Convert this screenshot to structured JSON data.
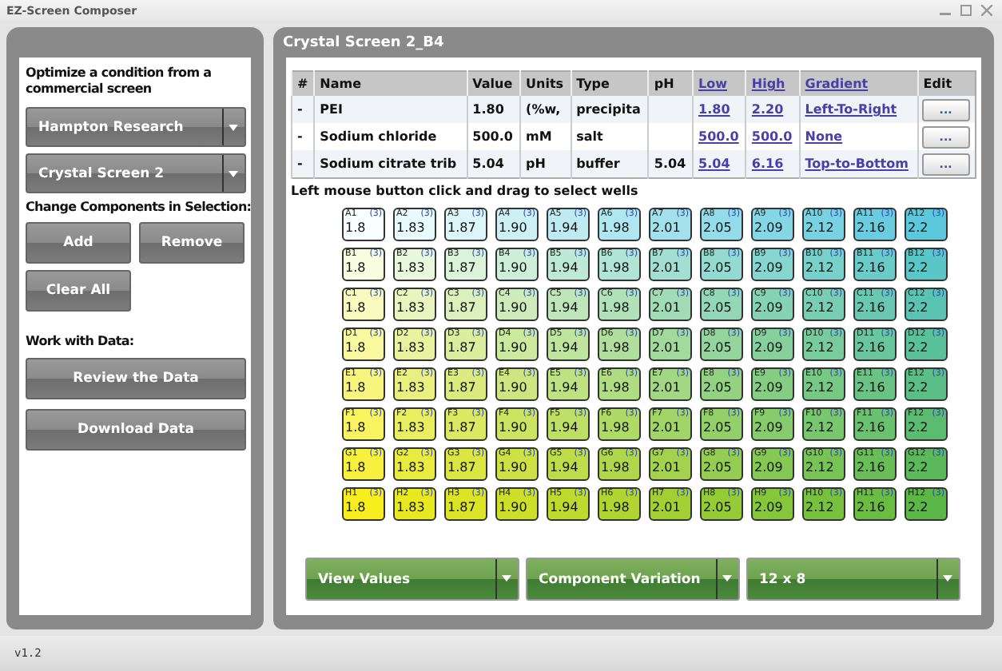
{
  "window": {
    "title": "EZ-Screen Composer"
  },
  "left_panel": {
    "heading": "Optimize a condition from a commercial screen",
    "dropdowns": [
      {
        "value": "Hampton Research"
      },
      {
        "value": "Crystal Screen 2"
      }
    ],
    "components_heading": "Change Components in Selection:",
    "component_buttons": [
      "Add",
      "Remove",
      "Clear All"
    ],
    "data_heading": "Work with Data:",
    "data_buttons": [
      "Review the Data",
      "Download Data"
    ]
  },
  "right_panel": {
    "title": "Crystal Screen 2_B4",
    "table": {
      "columns": [
        {
          "label": "#",
          "link": false
        },
        {
          "label": "Name",
          "link": false
        },
        {
          "label": "Value",
          "link": false
        },
        {
          "label": "Units",
          "link": false
        },
        {
          "label": "Type",
          "link": false
        },
        {
          "label": "pH",
          "link": false
        },
        {
          "label": "Low",
          "link": true
        },
        {
          "label": "High",
          "link": true
        },
        {
          "label": "Gradient",
          "link": true
        },
        {
          "label": "Edit",
          "link": false
        }
      ],
      "rows": [
        {
          "num": "-",
          "name": "PEI",
          "value": "1.80",
          "units": "(%w,",
          "type": "precipita",
          "ph": "",
          "low": "1.80",
          "high": "2.20",
          "gradient": "Left-To-Right",
          "edit": "..."
        },
        {
          "num": "-",
          "name": "Sodium chloride",
          "value": "500.0",
          "units": "mM",
          "type": "salt",
          "ph": "",
          "low": "500.0",
          "high": "500.0",
          "gradient": "None",
          "edit": "..."
        },
        {
          "num": "-",
          "name": "Sodium citrate trib",
          "value": "5.04",
          "units": "pH",
          "type": "buffer",
          "ph": "5.04",
          "low": "5.04",
          "high": "6.16",
          "gradient": "Top-to-Bottom",
          "edit": "..."
        }
      ]
    },
    "hint": "Left mouse button click and drag to select wells",
    "plate": [
      {
        "wells": [
          {
            "label": "A1",
            "count": "(3)",
            "value": "1.8",
            "color": "#f8ffff"
          },
          {
            "label": "A2",
            "count": "(3)",
            "value": "1.83",
            "color": "#e9fafc"
          },
          {
            "label": "A3",
            "count": "(3)",
            "value": "1.87",
            "color": "#dbf5f9"
          },
          {
            "label": "A4",
            "count": "(3)",
            "value": "1.90",
            "color": "#cdf0f5"
          },
          {
            "label": "A5",
            "count": "(3)",
            "value": "1.94",
            "color": "#beebf2"
          },
          {
            "label": "A6",
            "count": "(3)",
            "value": "1.98",
            "color": "#b0e6ef"
          },
          {
            "label": "A7",
            "count": "(3)",
            "value": "2.01",
            "color": "#a2e1ec"
          },
          {
            "label": "A8",
            "count": "(3)",
            "value": "2.05",
            "color": "#94dce9"
          },
          {
            "label": "A9",
            "count": "(3)",
            "value": "2.09",
            "color": "#86d7e6"
          },
          {
            "label": "A10",
            "count": "(3)",
            "value": "2.12",
            "color": "#78d2e2"
          },
          {
            "label": "A11",
            "count": "(3)",
            "value": "2.16",
            "color": "#6acddf"
          },
          {
            "label": "A12",
            "count": "(3)",
            "value": "2.2",
            "color": "#5bc8dc"
          }
        ]
      },
      {
        "wells": [
          {
            "label": "B1",
            "count": "(3)",
            "value": "1.8",
            "color": "#f8fddf"
          },
          {
            "label": "B2",
            "count": "(3)",
            "value": "1.83",
            "color": "#e9f8dd"
          },
          {
            "label": "B3",
            "count": "(3)",
            "value": "1.87",
            "color": "#dbf3db"
          },
          {
            "label": "B4",
            "count": "(3)",
            "value": "1.90",
            "color": "#cdeed8"
          },
          {
            "label": "B5",
            "count": "(3)",
            "value": "1.94",
            "color": "#bee9d6"
          },
          {
            "label": "B6",
            "count": "(3)",
            "value": "1.98",
            "color": "#b0e4d4"
          },
          {
            "label": "B7",
            "count": "(3)",
            "value": "2.01",
            "color": "#a2dfd2"
          },
          {
            "label": "B8",
            "count": "(3)",
            "value": "2.05",
            "color": "#94dad0"
          },
          {
            "label": "B9",
            "count": "(3)",
            "value": "2.09",
            "color": "#86d5ce"
          },
          {
            "label": "B10",
            "count": "(3)",
            "value": "2.12",
            "color": "#78d0cb"
          },
          {
            "label": "B11",
            "count": "(3)",
            "value": "2.16",
            "color": "#6acbc9"
          },
          {
            "label": "B12",
            "count": "(3)",
            "value": "2.2",
            "color": "#5bc6c7"
          }
        ]
      },
      {
        "wells": [
          {
            "label": "C1",
            "count": "(3)",
            "value": "1.8",
            "color": "#f8fabf"
          },
          {
            "label": "C2",
            "count": "(3)",
            "value": "1.83",
            "color": "#e9f5be"
          },
          {
            "label": "C3",
            "count": "(3)",
            "value": "1.87",
            "color": "#dbf0bc"
          },
          {
            "label": "C4",
            "count": "(3)",
            "value": "1.90",
            "color": "#cdebbb"
          },
          {
            "label": "C5",
            "count": "(3)",
            "value": "1.94",
            "color": "#bee6ba"
          },
          {
            "label": "C6",
            "count": "(3)",
            "value": "1.98",
            "color": "#b0e1b8"
          },
          {
            "label": "C7",
            "count": "(3)",
            "value": "2.01",
            "color": "#a2dcb7"
          },
          {
            "label": "C8",
            "count": "(3)",
            "value": "2.05",
            "color": "#94d7b6"
          },
          {
            "label": "C9",
            "count": "(3)",
            "value": "2.09",
            "color": "#86d2b5"
          },
          {
            "label": "C10",
            "count": "(3)",
            "value": "2.12",
            "color": "#78cdb3"
          },
          {
            "label": "C11",
            "count": "(3)",
            "value": "2.16",
            "color": "#6ac8b2"
          },
          {
            "label": "C12",
            "count": "(3)",
            "value": "2.2",
            "color": "#5bc3b1"
          }
        ]
      },
      {
        "wells": [
          {
            "label": "D1",
            "count": "(3)",
            "value": "1.8",
            "color": "#f8f89f"
          },
          {
            "label": "D2",
            "count": "(3)",
            "value": "1.83",
            "color": "#e9f39f"
          },
          {
            "label": "D3",
            "count": "(3)",
            "value": "1.87",
            "color": "#dbee9e"
          },
          {
            "label": "D4",
            "count": "(3)",
            "value": "1.90",
            "color": "#cde99e"
          },
          {
            "label": "D5",
            "count": "(3)",
            "value": "1.94",
            "color": "#bee49e"
          },
          {
            "label": "D6",
            "count": "(3)",
            "value": "1.98",
            "color": "#b0df9d"
          },
          {
            "label": "D7",
            "count": "(3)",
            "value": "2.01",
            "color": "#a2da9d"
          },
          {
            "label": "D8",
            "count": "(3)",
            "value": "2.05",
            "color": "#94d59d"
          },
          {
            "label": "D9",
            "count": "(3)",
            "value": "2.09",
            "color": "#86d09d"
          },
          {
            "label": "D10",
            "count": "(3)",
            "value": "2.12",
            "color": "#78cb9c"
          },
          {
            "label": "D11",
            "count": "(3)",
            "value": "2.16",
            "color": "#6ac69c"
          },
          {
            "label": "D12",
            "count": "(3)",
            "value": "2.2",
            "color": "#5bc19c"
          }
        ]
      },
      {
        "wells": [
          {
            "label": "E1",
            "count": "(3)",
            "value": "1.8",
            "color": "#f8f57f"
          },
          {
            "label": "E2",
            "count": "(3)",
            "value": "1.83",
            "color": "#e9f080"
          },
          {
            "label": "E3",
            "count": "(3)",
            "value": "1.87",
            "color": "#dbeb80"
          },
          {
            "label": "E4",
            "count": "(3)",
            "value": "1.90",
            "color": "#cde681"
          },
          {
            "label": "E5",
            "count": "(3)",
            "value": "1.94",
            "color": "#bee182"
          },
          {
            "label": "E6",
            "count": "(3)",
            "value": "1.98",
            "color": "#b0dc82"
          },
          {
            "label": "E7",
            "count": "(3)",
            "value": "2.01",
            "color": "#a2d783"
          },
          {
            "label": "E8",
            "count": "(3)",
            "value": "2.05",
            "color": "#94d283"
          },
          {
            "label": "E9",
            "count": "(3)",
            "value": "2.09",
            "color": "#86cd84"
          },
          {
            "label": "E10",
            "count": "(3)",
            "value": "2.12",
            "color": "#78c885"
          },
          {
            "label": "E11",
            "count": "(3)",
            "value": "2.16",
            "color": "#6ac385"
          },
          {
            "label": "E12",
            "count": "(3)",
            "value": "2.2",
            "color": "#5bbe86"
          }
        ]
      },
      {
        "wells": [
          {
            "label": "F1",
            "count": "(3)",
            "value": "1.8",
            "color": "#f8f35e"
          },
          {
            "label": "F2",
            "count": "(3)",
            "value": "1.83",
            "color": "#e9ee60"
          },
          {
            "label": "F3",
            "count": "(3)",
            "value": "1.87",
            "color": "#dbe962"
          },
          {
            "label": "F4",
            "count": "(3)",
            "value": "1.90",
            "color": "#cde463"
          },
          {
            "label": "F5",
            "count": "(3)",
            "value": "1.94",
            "color": "#bedf65"
          },
          {
            "label": "F6",
            "count": "(3)",
            "value": "1.98",
            "color": "#b0da66"
          },
          {
            "label": "F7",
            "count": "(3)",
            "value": "2.01",
            "color": "#a2d568"
          },
          {
            "label": "F8",
            "count": "(3)",
            "value": "2.05",
            "color": "#94d06a"
          },
          {
            "label": "F9",
            "count": "(3)",
            "value": "2.09",
            "color": "#86cb6c"
          },
          {
            "label": "F10",
            "count": "(3)",
            "value": "2.12",
            "color": "#78c66e"
          },
          {
            "label": "F11",
            "count": "(3)",
            "value": "2.16",
            "color": "#6ac16f"
          },
          {
            "label": "F12",
            "count": "(3)",
            "value": "2.2",
            "color": "#5bbc71"
          }
        ]
      },
      {
        "wells": [
          {
            "label": "G1",
            "count": "(3)",
            "value": "1.8",
            "color": "#f8f03e"
          },
          {
            "label": "G2",
            "count": "(3)",
            "value": "1.83",
            "color": "#e9eb41"
          },
          {
            "label": "G3",
            "count": "(3)",
            "value": "1.87",
            "color": "#dbe643"
          },
          {
            "label": "G4",
            "count": "(3)",
            "value": "1.90",
            "color": "#cde146"
          },
          {
            "label": "G5",
            "count": "(3)",
            "value": "1.94",
            "color": "#bedc49"
          },
          {
            "label": "G6",
            "count": "(3)",
            "value": "1.98",
            "color": "#b0d74b"
          },
          {
            "label": "G7",
            "count": "(3)",
            "value": "2.01",
            "color": "#a2d24e"
          },
          {
            "label": "G8",
            "count": "(3)",
            "value": "2.05",
            "color": "#94cd51"
          },
          {
            "label": "G9",
            "count": "(3)",
            "value": "2.09",
            "color": "#86c854"
          },
          {
            "label": "G10",
            "count": "(3)",
            "value": "2.12",
            "color": "#78c356"
          },
          {
            "label": "G11",
            "count": "(3)",
            "value": "2.16",
            "color": "#6abe58"
          },
          {
            "label": "G12",
            "count": "(3)",
            "value": "2.2",
            "color": "#5bb95b"
          }
        ]
      },
      {
        "wells": [
          {
            "label": "H1",
            "count": "(3)",
            "value": "1.8",
            "color": "#f8ee1e"
          },
          {
            "label": "H2",
            "count": "(3)",
            "value": "1.83",
            "color": "#e9e922"
          },
          {
            "label": "H3",
            "count": "(3)",
            "value": "1.87",
            "color": "#dbe425"
          },
          {
            "label": "H4",
            "count": "(3)",
            "value": "1.90",
            "color": "#cddf29"
          },
          {
            "label": "H5",
            "count": "(3)",
            "value": "1.94",
            "color": "#beda2d"
          },
          {
            "label": "H6",
            "count": "(3)",
            "value": "1.98",
            "color": "#b0d530"
          },
          {
            "label": "H7",
            "count": "(3)",
            "value": "2.01",
            "color": "#a2d034"
          },
          {
            "label": "H8",
            "count": "(3)",
            "value": "2.05",
            "color": "#94cb37"
          },
          {
            "label": "H9",
            "count": "(3)",
            "value": "2.09",
            "color": "#86c63b"
          },
          {
            "label": "H10",
            "count": "(3)",
            "value": "2.12",
            "color": "#78c13f"
          },
          {
            "label": "H11",
            "count": "(3)",
            "value": "2.16",
            "color": "#6abc42"
          },
          {
            "label": "H12",
            "count": "(3)",
            "value": "2.2",
            "color": "#5bb746"
          }
        ]
      }
    ],
    "dropdowns": [
      {
        "value": "View Values"
      },
      {
        "value": "Component Variation"
      },
      {
        "value": "12 x 8"
      }
    ]
  },
  "status_bar": {
    "version": "v1.2"
  }
}
